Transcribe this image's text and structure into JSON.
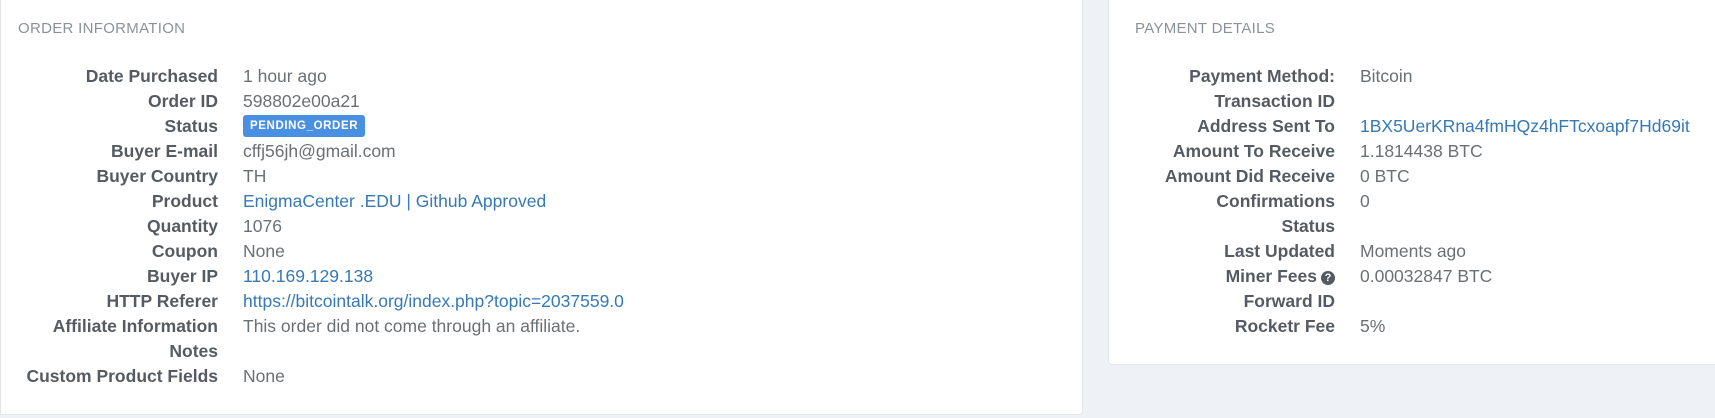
{
  "order_information": {
    "title": "ORDER INFORMATION",
    "rows": [
      {
        "label": "Date Purchased",
        "value": "1 hour ago"
      },
      {
        "label": "Order ID",
        "value": "598802e00a21"
      },
      {
        "label": "Status",
        "value": "PENDING_ORDER"
      },
      {
        "label": "Buyer E-mail",
        "value": "cffj56jh@gmail.com"
      },
      {
        "label": "Buyer Country",
        "value": "TH"
      },
      {
        "label": "Product",
        "value": "EnigmaCenter .EDU | Github Approved"
      },
      {
        "label": "Quantity",
        "value": "1076"
      },
      {
        "label": "Coupon",
        "value": "None"
      },
      {
        "label": "Buyer IP",
        "value": "110.169.129.138"
      },
      {
        "label": "HTTP Referer",
        "value": "https://bitcointalk.org/index.php?topic=2037559.0"
      },
      {
        "label": "Affiliate Information",
        "value": "This order did not come through an affiliate."
      },
      {
        "label": "Notes",
        "value": ""
      },
      {
        "label": "Custom Product Fields",
        "value": "None"
      }
    ]
  },
  "payment_details": {
    "title": "PAYMENT DETAILS",
    "rows": [
      {
        "label": "Payment Method:",
        "value": "Bitcoin"
      },
      {
        "label": "Transaction ID",
        "value": ""
      },
      {
        "label": "Address Sent To",
        "value": "1BX5UerKRna4fmHQz4hFTcxoapf7Hd69it"
      },
      {
        "label": "Amount To Receive",
        "value": "1.1814438 BTC"
      },
      {
        "label": "Amount Did Receive",
        "value": "0 BTC"
      },
      {
        "label": "Confirmations",
        "value": "0"
      },
      {
        "label": "Status",
        "value": ""
      },
      {
        "label": "Last Updated",
        "value": "Moments ago"
      },
      {
        "label": "Miner Fees",
        "value": "0.00032847 BTC",
        "icon": "question-circle-icon"
      },
      {
        "label": "Forward ID",
        "value": ""
      },
      {
        "label": "Rocketr Fee",
        "value": "5%"
      }
    ]
  },
  "colors": {
    "link": "#3679b5",
    "badge": "#4a90e2",
    "background": "#eef1f5"
  }
}
